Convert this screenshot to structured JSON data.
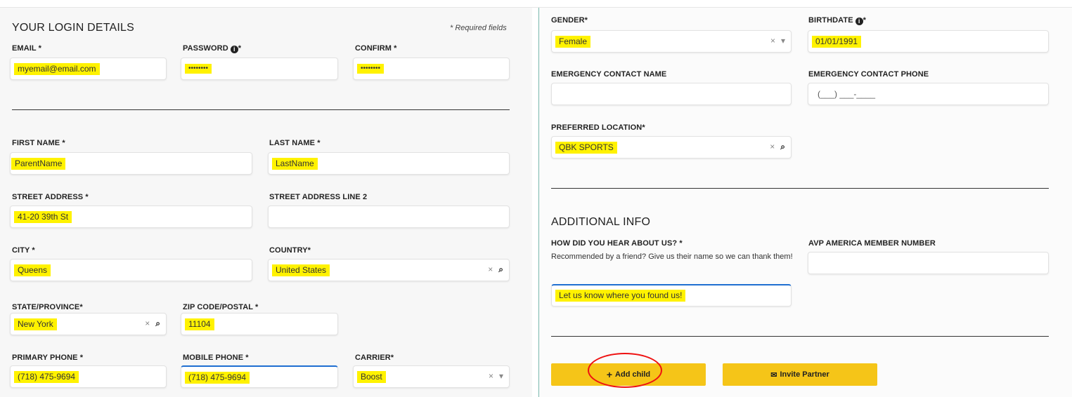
{
  "login": {
    "title": "YOUR LOGIN DETAILS",
    "required_note": "* Required fields",
    "email_label": "EMAIL *",
    "email_value": "myemail@email.com",
    "password_label": "PASSWORD",
    "password_suffix": "*",
    "password_value": "••••••••",
    "confirm_label": "CONFIRM *",
    "confirm_value": "••••••••"
  },
  "personal": {
    "first_name_label": "FIRST NAME *",
    "first_name_value": "ParentName",
    "last_name_label": "LAST NAME *",
    "last_name_value": "LastName",
    "street_label": "STREET ADDRESS *",
    "street_value": "41-20 39th St",
    "street2_label": "STREET ADDRESS LINE 2",
    "city_label": "CITY *",
    "city_value": "Queens",
    "country_label": "COUNTRY*",
    "country_value": "United States",
    "state_label": "STATE/PROVINCE*",
    "state_value": "New York",
    "zip_label": "ZIP CODE/POSTAL *",
    "zip_value": "11104",
    "primary_phone_label": "PRIMARY PHONE *",
    "primary_phone_value": "(718) 475-9694",
    "mobile_phone_label": "MOBILE PHONE *",
    "mobile_phone_value": "(718) 475-9694",
    "carrier_label": "CARRIER*",
    "carrier_value": "Boost"
  },
  "profile": {
    "gender_label": "GENDER*",
    "gender_value": "Female",
    "birthdate_label": "BIRTHDATE",
    "birthdate_suffix": "*",
    "birthdate_value": "01/01/1991",
    "emergency_name_label": "EMERGENCY CONTACT NAME",
    "emergency_phone_label": "EMERGENCY CONTACT PHONE",
    "emergency_phone_value": "(___) ___-____",
    "location_label": "PREFERRED LOCATION*",
    "location_value": "QBK SPORTS"
  },
  "additional": {
    "title": "ADDITIONAL INFO",
    "hear_label": "HOW DID YOU HEAR ABOUT US? *",
    "hear_help": "Recommended by a friend? Give us their name so we can thank them!",
    "hear_value": "Let us know where you found us!",
    "avp_label": "AVP AMERICA MEMBER NUMBER"
  },
  "controls": {
    "clear": "×",
    "caret": "▾",
    "search": "🔍",
    "info": "i"
  },
  "buttons": {
    "add_child": "Add child",
    "add_child_icon": "+",
    "invite_partner": "Invite Partner",
    "invite_icon": "✉"
  },
  "colors": {
    "accent": "#f5c518",
    "highlight": "#fff200",
    "focus": "#1f6fd1",
    "annotation": "#ee1111"
  }
}
